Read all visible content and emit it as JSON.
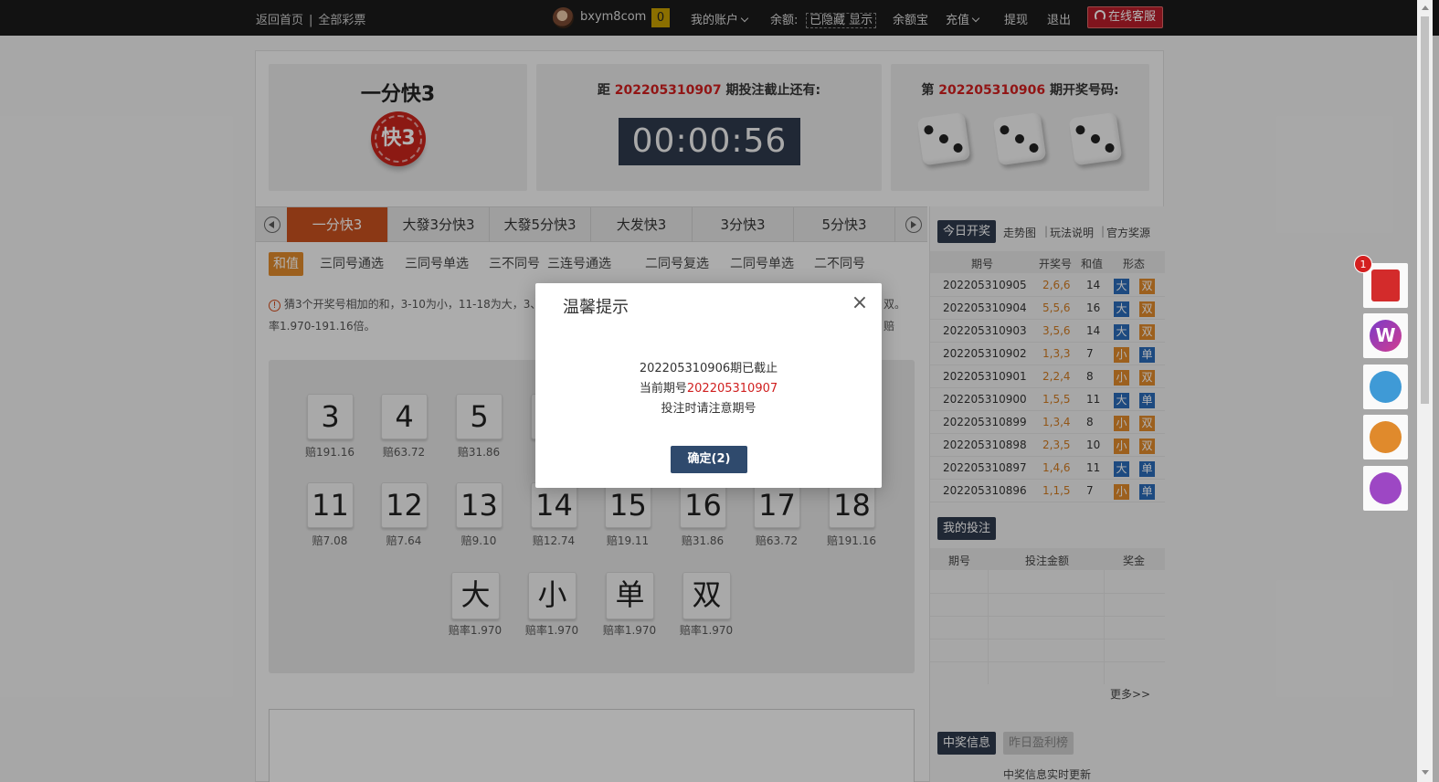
{
  "topbar": {
    "home": "返回首页",
    "all_lottery": "全部彩票",
    "username": "bxym8com",
    "msg_count": "0",
    "my_account": "我的账户",
    "balance_label": "余额:",
    "balance_value": "已隐藏 显示",
    "yuebao": "余额宝",
    "recharge": "充值",
    "withdraw": "提现",
    "logout": "退出",
    "online_service": "在线客服"
  },
  "game": {
    "title": "一分快3",
    "logo_text": "快3",
    "deadline_prefix": "距",
    "deadline_issue": "202205310907",
    "deadline_suffix": "期投注截止还有:",
    "countdown": "00:00:56",
    "result_prefix": "第",
    "result_issue": "202205310906",
    "result_suffix": "期开奖号码:",
    "dice": [
      3,
      3,
      3
    ]
  },
  "tabs": [
    "一分快3",
    "大發3分快3",
    "大發5分快3",
    "大发快3",
    "3分快3",
    "5分快3"
  ],
  "subtabs": [
    "和值",
    "三同号通选",
    "三同号单选",
    "三不同号",
    "三连号通选",
    "二同号复选",
    "二同号单选",
    "二不同号"
  ],
  "rule": {
    "line1": "猜3个开奖号相加的和，3-10为小，11-18为大，3、",
    "line1_tail": "双。赔",
    "line2": "率1.970-191.16倍。"
  },
  "balls_row1": [
    {
      "n": "3",
      "odds": "赔191.16"
    },
    {
      "n": "4",
      "odds": "赔63.72"
    },
    {
      "n": "5",
      "odds": "赔31.86"
    }
  ],
  "balls_row2": [
    {
      "n": "11",
      "odds": "赔7.08"
    },
    {
      "n": "12",
      "odds": "赔7.64"
    },
    {
      "n": "13",
      "odds": "赔9.10"
    },
    {
      "n": "14",
      "odds": "赔12.74"
    },
    {
      "n": "15",
      "odds": "赔19.11"
    },
    {
      "n": "16",
      "odds": "赔31.86"
    },
    {
      "n": "17",
      "odds": "赔63.72"
    },
    {
      "n": "18",
      "odds": "赔191.16"
    }
  ],
  "balls_row3": [
    {
      "n": "大",
      "odds": "赔率1.970"
    },
    {
      "n": "小",
      "odds": "赔率1.970"
    },
    {
      "n": "单",
      "odds": "赔率1.970"
    },
    {
      "n": "双",
      "odds": "赔率1.970"
    }
  ],
  "right_panel": {
    "today_draw": "今日开奖",
    "trend": "走势图",
    "howto": "玩法说明",
    "official": "官方奖源",
    "head": [
      "期号",
      "开奖号",
      "和值",
      "形态"
    ],
    "rows": [
      {
        "issue": "202205310905",
        "nums": "2,6,6",
        "sum": "14",
        "size": "大",
        "parity": "双"
      },
      {
        "issue": "202205310904",
        "nums": "5,5,6",
        "sum": "16",
        "size": "大",
        "parity": "双"
      },
      {
        "issue": "202205310903",
        "nums": "3,5,6",
        "sum": "14",
        "size": "大",
        "parity": "双"
      },
      {
        "issue": "202205310902",
        "nums": "1,3,3",
        "sum": "7",
        "size": "小",
        "parity": "单"
      },
      {
        "issue": "202205310901",
        "nums": "2,2,4",
        "sum": "8",
        "size": "小",
        "parity": "双"
      },
      {
        "issue": "202205310900",
        "nums": "1,5,5",
        "sum": "11",
        "size": "大",
        "parity": "单"
      },
      {
        "issue": "202205310899",
        "nums": "1,3,4",
        "sum": "8",
        "size": "小",
        "parity": "双"
      },
      {
        "issue": "202205310898",
        "nums": "2,3,5",
        "sum": "10",
        "size": "小",
        "parity": "双"
      },
      {
        "issue": "202205310897",
        "nums": "1,4,6",
        "sum": "11",
        "size": "大",
        "parity": "单"
      },
      {
        "issue": "202205310896",
        "nums": "1,1,5",
        "sum": "7",
        "size": "小",
        "parity": "单"
      }
    ],
    "my_bets": "我的投注",
    "bets_head": [
      "期号",
      "投注金额",
      "奖金"
    ],
    "more": "更多>>",
    "win_info": "中奖信息",
    "yesterday": "昨日盈利榜",
    "win_live": "中奖信息实时更新"
  },
  "float": {
    "badge": "1"
  },
  "modal": {
    "title": "温馨提示",
    "line1": "202205310906期已截止",
    "line2_prefix": "当前期号",
    "line2_issue": "202205310907",
    "line3": "投注时请注意期号",
    "confirm": "确定(2)"
  },
  "colors": {
    "accent": "#c8511f",
    "navy": "#2f3a4d",
    "red": "#d01f1f",
    "orange": "#e08a2c",
    "blue": "#2a6bb8"
  }
}
